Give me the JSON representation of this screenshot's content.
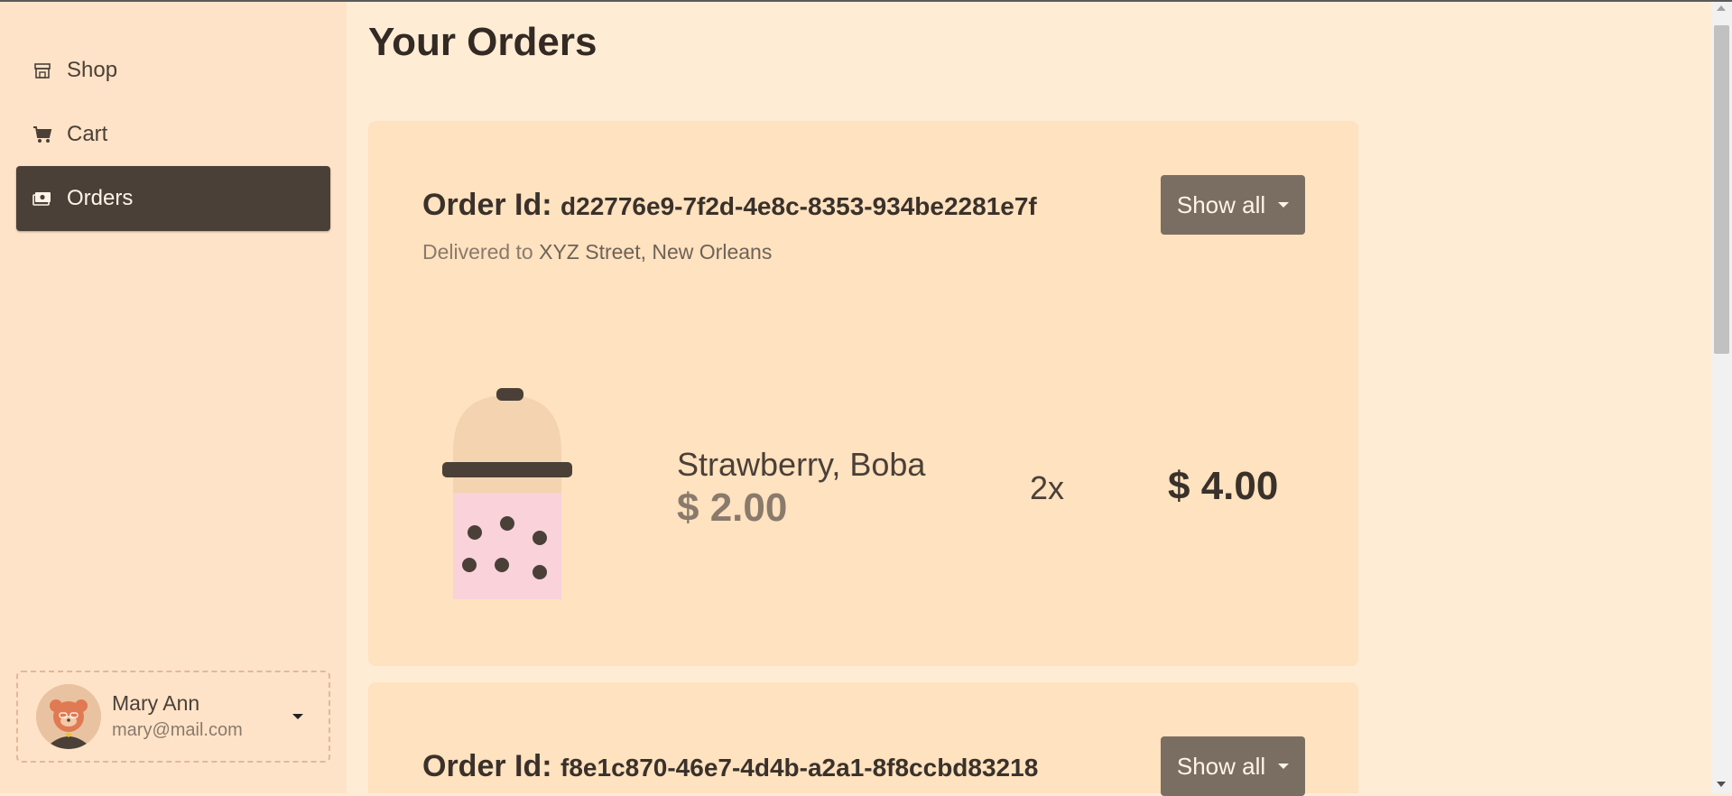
{
  "sidebar": {
    "items": [
      {
        "label": "Shop",
        "icon": "store-icon"
      },
      {
        "label": "Cart",
        "icon": "cart-icon"
      },
      {
        "label": "Orders",
        "icon": "orders-icon",
        "active": true
      }
    ],
    "user": {
      "name": "Mary Ann",
      "email": "mary@mail.com"
    }
  },
  "main": {
    "title": "Your Orders",
    "orders": [
      {
        "id_label": "Order Id:",
        "id": "d22776e9-7f2d-4e8c-8353-934be2281e7f",
        "delivered_prefix": "Delivered to",
        "address": "XYZ Street, New Orleans",
        "show_all_label": "Show all",
        "items": [
          {
            "name": "Strawberry, Boba",
            "price": "$ 2.00",
            "qty": "2x",
            "total": "$ 4.00"
          }
        ]
      },
      {
        "id_label": "Order Id:",
        "id": "f8e1c870-46e7-4d4b-a2a1-8f8ccbd83218",
        "show_all_label": "Show all"
      }
    ]
  },
  "colors": {
    "sidebar_bg": "#ffe3c8",
    "page_bg": "#ffecd5",
    "card_bg": "#ffe2bf",
    "active_nav": "#4a4038",
    "button": "#7a6e62",
    "drink_pink": "#f9d2da"
  }
}
